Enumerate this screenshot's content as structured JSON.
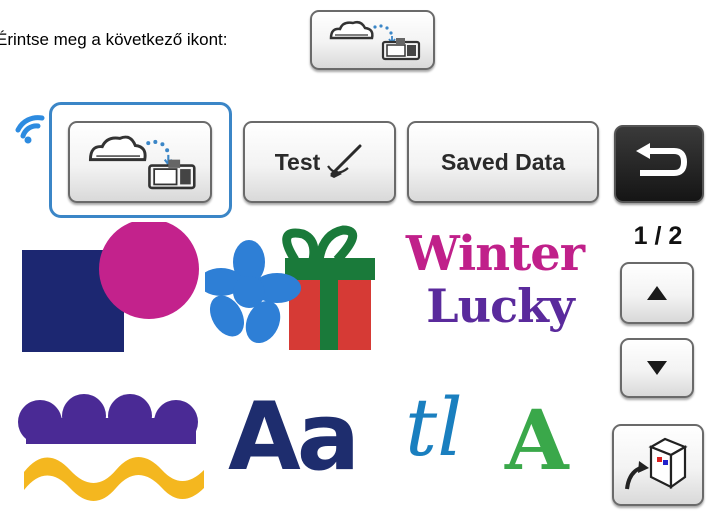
{
  "instruction": {
    "text": "Érintse meg a következő ikont:"
  },
  "toolbar": {
    "cloud_transfer_icon": "cloud-to-machine-icon",
    "test_label": "Test",
    "test_icon": "pen-cut-icon",
    "saved_data_label": "Saved Data",
    "back_icon": "return-arrow-icon"
  },
  "status": {
    "wifi_icon": "wifi-icon"
  },
  "pagination": {
    "indicator": "1 / 2",
    "up_icon": "triangle-up-icon",
    "down_icon": "triangle-down-icon"
  },
  "side": {
    "storage_icon": "scan-storage-icon"
  },
  "patterns": [
    {
      "name": "basic-shapes-pattern",
      "icon": "square-circle-icon"
    },
    {
      "name": "flower-gift-pattern",
      "icon": "flower-gift-icon"
    },
    {
      "name": "winter-lucky-pattern",
      "icon": "word-art-icon",
      "line1": "Winter",
      "line2": "Lucky"
    },
    {
      "name": "wave-border-pattern",
      "icon": "wave-border-icon"
    },
    {
      "name": "font-pattern",
      "icon": "font-icon",
      "text": "Aa"
    },
    {
      "name": "decorative-font-pattern",
      "icon": "decorative-letters-icon",
      "text1": "tl",
      "text2": "A"
    }
  ],
  "colors": {
    "highlight": "#3b86c7",
    "back_button": "#1a1a1a"
  }
}
